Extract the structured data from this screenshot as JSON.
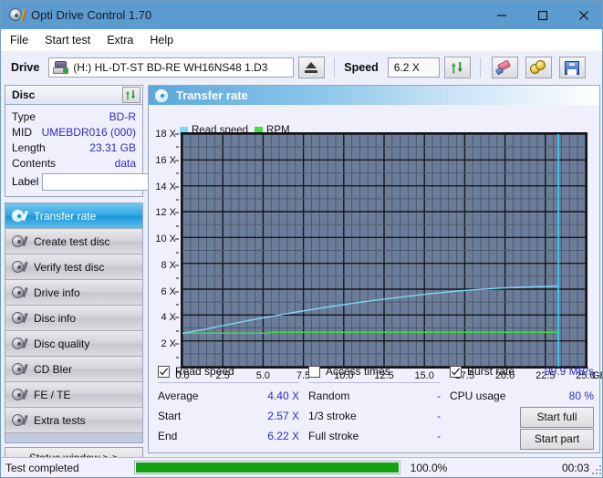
{
  "window": {
    "title": "Opti Drive Control 1.70",
    "icon": "disc-pen-icon",
    "minimize": "─",
    "maximize": "□",
    "close": "✕"
  },
  "menu": {
    "items": [
      "File",
      "Start test",
      "Extra",
      "Help"
    ]
  },
  "toolbar": {
    "drive_label": "Drive",
    "drive_value": "(H:)  HL-DT-ST BD-RE  WH16NS48 1.D3",
    "eject_icon": "eject-icon",
    "speed_label": "Speed",
    "speed_value": "6.2 X",
    "refresh_icon": "refresh-icon",
    "eraser_icon": "eraser-icon",
    "coins_icon": "coins-icon",
    "save_icon": "save-icon"
  },
  "disc_panel": {
    "title": "Disc",
    "refresh_icon": "refresh-icon",
    "rows": [
      {
        "key": "Type",
        "value": "BD-R"
      },
      {
        "key": "MID",
        "value": "UMEBDR016 (000)"
      },
      {
        "key": "Length",
        "value": "23.31 GB"
      },
      {
        "key": "Contents",
        "value": "data"
      }
    ],
    "label_key": "Label",
    "label_value": "",
    "label_placeholder": "",
    "label_button_icon": "cd-icon"
  },
  "nav": {
    "items": [
      {
        "label": "Transfer rate",
        "selected": true
      },
      {
        "label": "Create test disc",
        "selected": false
      },
      {
        "label": "Verify test disc",
        "selected": false
      },
      {
        "label": "Drive info",
        "selected": false
      },
      {
        "label": "Disc info",
        "selected": false
      },
      {
        "label": "Disc quality",
        "selected": false
      },
      {
        "label": "CD Bler",
        "selected": false
      },
      {
        "label": "FE / TE",
        "selected": false
      },
      {
        "label": "Extra tests",
        "selected": false
      }
    ],
    "status_window": "Status window > >"
  },
  "panel": {
    "header_title": "Transfer rate",
    "header_icon": "disc-icon"
  },
  "chart_data": {
    "type": "line",
    "title": "Transfer rate",
    "xlabel": "GB",
    "ylabel": "X",
    "xlim": [
      0.0,
      25.0
    ],
    "ylim": [
      0,
      18
    ],
    "xticks": [
      "0.0",
      "2.5",
      "5.0",
      "7.5",
      "10.0",
      "12.5",
      "15.0",
      "17.5",
      "20.0",
      "22.5",
      "25.0"
    ],
    "xtick_values": [
      0.0,
      2.5,
      5.0,
      7.5,
      10.0,
      12.5,
      15.0,
      17.5,
      20.0,
      22.5,
      25.0
    ],
    "x_unit": "GB",
    "yticks": [
      "2 X",
      "4 X",
      "6 X",
      "8 X",
      "10 X",
      "12 X",
      "14 X",
      "16 X",
      "18 X"
    ],
    "ytick_values": [
      2,
      4,
      6,
      8,
      10,
      12,
      14,
      16,
      18
    ],
    "grid": true,
    "plot_bg": "#6c7d99",
    "legend_position": "top-left",
    "legend": [
      {
        "name": "Read speed",
        "color": "#7fd8f5"
      },
      {
        "name": "RPM",
        "color": "#3ee03e"
      }
    ],
    "series": [
      {
        "name": "Read speed",
        "color": "#7fd8f5",
        "points": [
          [
            0.0,
            2.57
          ],
          [
            1.0,
            2.8
          ],
          [
            2.0,
            3.05
          ],
          [
            3.0,
            3.3
          ],
          [
            4.0,
            3.55
          ],
          [
            5.0,
            3.78
          ],
          [
            6.0,
            4.0
          ],
          [
            7.0,
            4.22
          ],
          [
            8.0,
            4.42
          ],
          [
            9.0,
            4.62
          ],
          [
            10.0,
            4.8
          ],
          [
            11.0,
            4.98
          ],
          [
            12.0,
            5.15
          ],
          [
            13.0,
            5.31
          ],
          [
            14.0,
            5.46
          ],
          [
            15.0,
            5.6
          ],
          [
            16.0,
            5.73
          ],
          [
            17.0,
            5.85
          ],
          [
            18.0,
            5.95
          ],
          [
            19.0,
            6.03
          ],
          [
            20.0,
            6.1
          ],
          [
            21.0,
            6.15
          ],
          [
            22.0,
            6.19
          ],
          [
            23.0,
            6.22
          ],
          [
            23.31,
            6.22
          ]
        ]
      },
      {
        "name": "RPM",
        "color": "#3ee03e",
        "points": [
          [
            0.0,
            2.6
          ],
          [
            5.3,
            2.6
          ],
          [
            5.4,
            2.66
          ],
          [
            23.31,
            2.66
          ]
        ]
      }
    ],
    "cursor_x": 23.31,
    "cursor_color": "#35c6ee"
  },
  "stats": {
    "read_speed": {
      "checkbox_label": "Read speed",
      "checked": true,
      "rows": [
        {
          "key": "Average",
          "value": "4.40 X"
        },
        {
          "key": "Start",
          "value": "2.57 X"
        },
        {
          "key": "End",
          "value": "6.22 X"
        }
      ]
    },
    "access_times": {
      "checkbox_label": "Access times",
      "checked": false,
      "rows": [
        {
          "key": "Random",
          "value": "-"
        },
        {
          "key": "1/3 stroke",
          "value": "-"
        },
        {
          "key": "Full stroke",
          "value": "-"
        }
      ]
    },
    "burst": {
      "checkbox_label": "Burst rate",
      "checked": true,
      "burst_value": "99.9 MB/s",
      "cpu_key": "CPU usage",
      "cpu_value": "80 %",
      "start_full": "Start full",
      "start_part": "Start part"
    }
  },
  "statusbar": {
    "text": "Test completed",
    "progress_percent": 100.0,
    "percent_label": "100.0%",
    "time": "00:03",
    "progress_color": "#13a013"
  }
}
